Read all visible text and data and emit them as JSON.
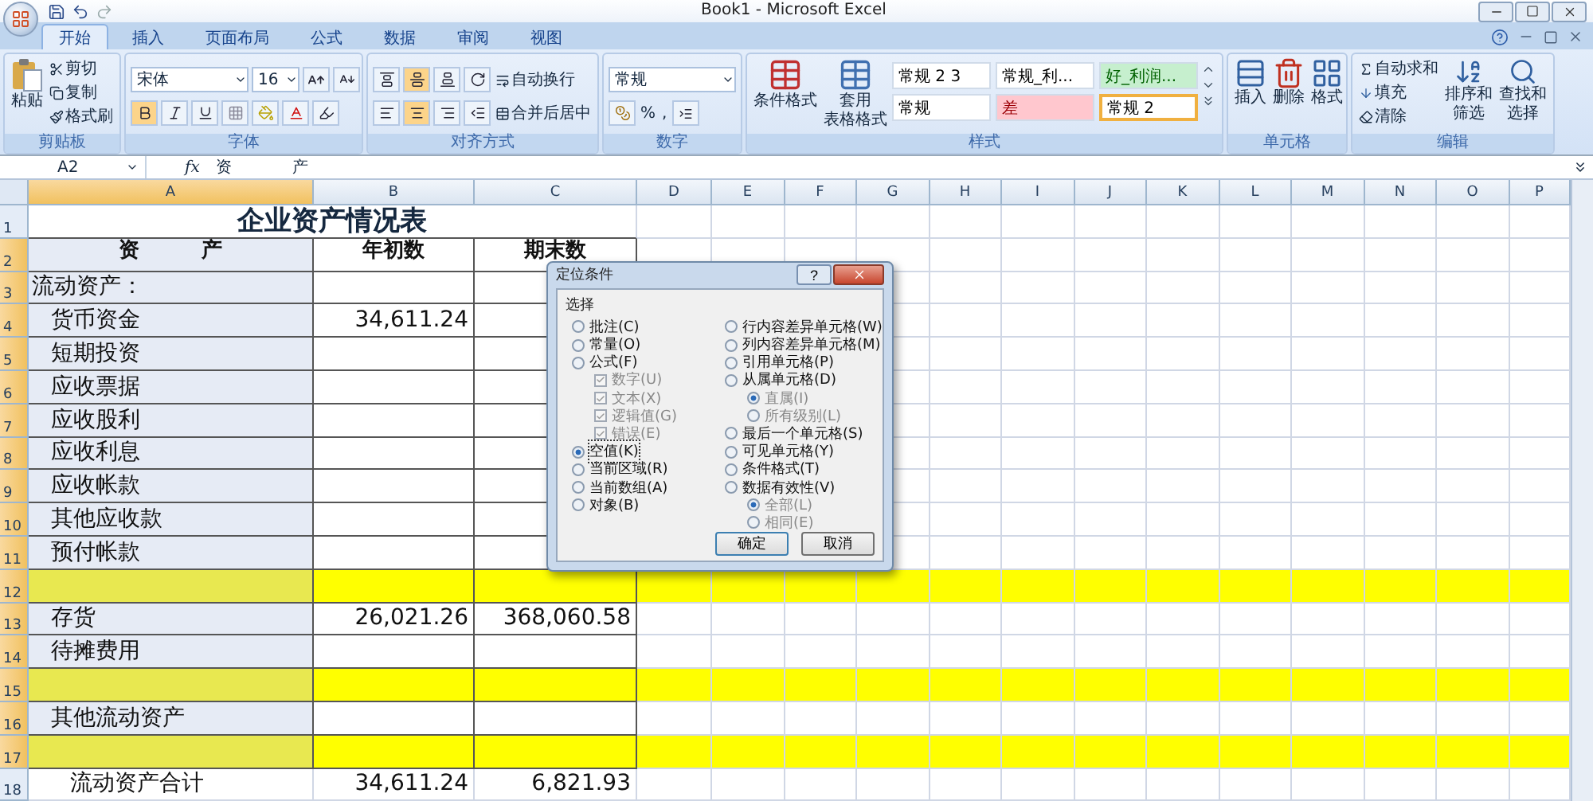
{
  "window": {
    "title": "Book1 - Microsoft Excel"
  },
  "tabs": [
    {
      "label": "开始",
      "selected": true
    },
    {
      "label": "插入",
      "selected": false
    },
    {
      "label": "页面布局",
      "selected": false
    },
    {
      "label": "公式",
      "selected": false
    },
    {
      "label": "数据",
      "selected": false
    },
    {
      "label": "审阅",
      "selected": false
    },
    {
      "label": "视图",
      "selected": false
    }
  ],
  "ribbon": {
    "clipboard": {
      "paste": "粘贴",
      "cut": "剪切",
      "copy": "复制",
      "format_painter": "格式刷",
      "label": "剪贴板"
    },
    "font": {
      "font_name": "宋体",
      "font_size": "16",
      "label": "字体"
    },
    "alignment": {
      "wrap": "自动换行",
      "merge": "合并后居中",
      "label": "对齐方式"
    },
    "number": {
      "format": "常规",
      "percent": "%",
      "comma": ",",
      "label": "数字"
    },
    "styles": {
      "conditional": "条件格式",
      "table_format": "套用",
      "table_format_2": "表格格式",
      "label": "样式",
      "gallery": [
        {
          "label": "常规 2 3",
          "color": "#ffffff",
          "kind": "normal",
          "selected": false
        },
        {
          "label": "常规_利...",
          "color": "#ffffff",
          "kind": "normal",
          "selected": false
        },
        {
          "label": "好_利润...",
          "color": "#c6efce",
          "kind": "good",
          "selected": false
        },
        {
          "label": "常规",
          "color": "#ffffff",
          "kind": "normal",
          "selected": false
        },
        {
          "label": "差",
          "color": "#ffc7ce",
          "kind": "bad",
          "selected": false
        },
        {
          "label": "常规 2",
          "color": "#ffffff",
          "kind": "normal",
          "selected": true
        }
      ]
    },
    "cells": {
      "insert": "插入",
      "delete": "删除",
      "format": "格式",
      "label": "单元格"
    },
    "editing": {
      "autosum": "自动求和",
      "fill": "填充",
      "clear": "清除",
      "sort": "排序和",
      "sort_2": "筛选",
      "find": "查找和",
      "find_2": "选择",
      "label": "编辑"
    }
  },
  "formula_bar": {
    "name_box": "A2",
    "fx": "fx",
    "formula": "资            产"
  },
  "columns": [
    {
      "label": "A",
      "selected": true
    },
    {
      "label": "B",
      "selected": false
    },
    {
      "label": "C",
      "selected": false
    },
    {
      "label": "D",
      "selected": false
    },
    {
      "label": "E",
      "selected": false
    },
    {
      "label": "F",
      "selected": false
    },
    {
      "label": "G",
      "selected": false
    },
    {
      "label": "H",
      "selected": false
    },
    {
      "label": "I",
      "selected": false
    },
    {
      "label": "J",
      "selected": false
    },
    {
      "label": "K",
      "selected": false
    },
    {
      "label": "L",
      "selected": false
    },
    {
      "label": "M",
      "selected": false
    },
    {
      "label": "N",
      "selected": false
    },
    {
      "label": "O",
      "selected": false
    },
    {
      "label": "P",
      "selected": false
    }
  ],
  "rows": [
    {
      "number": "1",
      "kind": "title",
      "selected": false,
      "highlighted": false,
      "cells": [
        "企业资产情况表"
      ]
    },
    {
      "number": "2",
      "kind": "header",
      "selected": true,
      "highlighted": false,
      "cells": [
        "资　　　产",
        "年初数",
        "期末数"
      ]
    },
    {
      "number": "3",
      "kind": "group",
      "selected": true,
      "highlighted": false,
      "cells": [
        "流动资产：",
        "",
        ""
      ]
    },
    {
      "number": "4",
      "kind": "item",
      "selected": true,
      "highlighted": false,
      "cells": [
        "货币资金",
        "34,611.24",
        ""
      ]
    },
    {
      "number": "5",
      "kind": "item",
      "selected": true,
      "highlighted": false,
      "cells": [
        "短期投资",
        "",
        ""
      ]
    },
    {
      "number": "6",
      "kind": "item",
      "selected": true,
      "highlighted": false,
      "cells": [
        "应收票据",
        "",
        ""
      ]
    },
    {
      "number": "7",
      "kind": "item",
      "selected": true,
      "highlighted": false,
      "cells": [
        "应收股利",
        "",
        ""
      ]
    },
    {
      "number": "8",
      "kind": "item",
      "selected": true,
      "highlighted": false,
      "cells": [
        "应收利息",
        "",
        ""
      ]
    },
    {
      "number": "9",
      "kind": "item",
      "selected": true,
      "highlighted": false,
      "cells": [
        "应收帐款",
        "",
        ""
      ]
    },
    {
      "number": "10",
      "kind": "item",
      "selected": true,
      "highlighted": false,
      "cells": [
        "其他应收款",
        "",
        ""
      ]
    },
    {
      "number": "11",
      "kind": "item",
      "selected": true,
      "highlighted": false,
      "cells": [
        "预付帐款",
        "",
        ""
      ]
    },
    {
      "number": "12",
      "kind": "item",
      "selected": true,
      "highlighted": true,
      "cells": [
        "",
        "",
        ""
      ]
    },
    {
      "number": "13",
      "kind": "item",
      "selected": true,
      "highlighted": false,
      "cells": [
        "存货",
        "26,021.26",
        "368,060.58"
      ]
    },
    {
      "number": "14",
      "kind": "item",
      "selected": true,
      "highlighted": false,
      "cells": [
        "待摊费用",
        "",
        ""
      ]
    },
    {
      "number": "15",
      "kind": "item",
      "selected": true,
      "highlighted": true,
      "cells": [
        "",
        "",
        ""
      ]
    },
    {
      "number": "16",
      "kind": "item",
      "selected": true,
      "highlighted": false,
      "cells": [
        "其他流动资产",
        "",
        ""
      ]
    },
    {
      "number": "17",
      "kind": "item",
      "selected": true,
      "highlighted": true,
      "cells": [
        "",
        "",
        ""
      ]
    },
    {
      "number": "18",
      "kind": "total",
      "selected": false,
      "highlighted": false,
      "cells": [
        "流动资产合计",
        "34,611.24",
        "6,821.93"
      ]
    }
  ],
  "dialog": {
    "title": "定位条件",
    "help": "?",
    "group": "选择",
    "left": [
      {
        "label": "批注(C)",
        "kind": "radio",
        "selected": false,
        "disabled": false
      },
      {
        "label": "常量(O)",
        "kind": "radio",
        "selected": false,
        "disabled": false
      },
      {
        "label": "公式(F)",
        "kind": "radio",
        "selected": false,
        "disabled": false,
        "children": [
          {
            "label": "数字(U)",
            "kind": "checkbox",
            "checked": true,
            "disabled": true
          },
          {
            "label": "文本(X)",
            "kind": "checkbox",
            "checked": true,
            "disabled": true
          },
          {
            "label": "逻辑值(G)",
            "kind": "checkbox",
            "checked": true,
            "disabled": true
          },
          {
            "label": "错误(E)",
            "kind": "checkbox",
            "checked": true,
            "disabled": true
          }
        ]
      },
      {
        "label": "空值(K)",
        "kind": "radio",
        "selected": true,
        "disabled": false
      },
      {
        "label": "当前区域(R)",
        "kind": "radio",
        "selected": false,
        "disabled": false
      },
      {
        "label": "当前数组(A)",
        "kind": "radio",
        "selected": false,
        "disabled": false
      },
      {
        "label": "对象(B)",
        "kind": "radio",
        "selected": false,
        "disabled": false
      }
    ],
    "right": [
      {
        "label": "行内容差异单元格(W)",
        "kind": "radio",
        "selected": false,
        "disabled": false
      },
      {
        "label": "列内容差异单元格(M)",
        "kind": "radio",
        "selected": false,
        "disabled": false
      },
      {
        "label": "引用单元格(P)",
        "kind": "radio",
        "selected": false,
        "disabled": false
      },
      {
        "label": "从属单元格(D)",
        "kind": "radio",
        "selected": false,
        "disabled": false,
        "children": [
          {
            "label": "直属(I)",
            "kind": "radio",
            "selected": true,
            "disabled": true
          },
          {
            "label": "所有级别(L)",
            "kind": "radio",
            "selected": false,
            "disabled": true
          }
        ]
      },
      {
        "label": "最后一个单元格(S)",
        "kind": "radio",
        "selected": false,
        "disabled": false
      },
      {
        "label": "可见单元格(Y)",
        "kind": "radio",
        "selected": false,
        "disabled": false
      },
      {
        "label": "条件格式(T)",
        "kind": "radio",
        "selected": false,
        "disabled": false
      },
      {
        "label": "数据有效性(V)",
        "kind": "radio",
        "selected": false,
        "disabled": false,
        "children": [
          {
            "label": "全部(L)",
            "kind": "radio",
            "selected": true,
            "disabled": true
          },
          {
            "label": "相同(E)",
            "kind": "radio",
            "selected": false,
            "disabled": true
          }
        ]
      }
    ],
    "buttons": [
      "确定",
      "取消"
    ]
  }
}
